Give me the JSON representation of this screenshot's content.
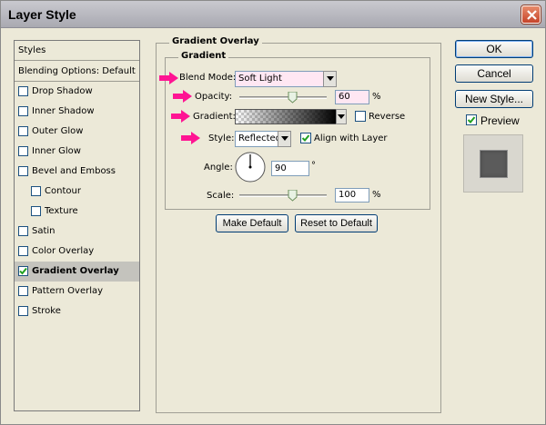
{
  "window": {
    "title": "Layer Style"
  },
  "sidebar": {
    "styles_label": "Styles",
    "blending_label": "Blending Options: Default",
    "items": [
      {
        "label": "Drop Shadow",
        "checked": false,
        "indent": false,
        "selected": false
      },
      {
        "label": "Inner Shadow",
        "checked": false,
        "indent": false,
        "selected": false
      },
      {
        "label": "Outer Glow",
        "checked": false,
        "indent": false,
        "selected": false
      },
      {
        "label": "Inner Glow",
        "checked": false,
        "indent": false,
        "selected": false
      },
      {
        "label": "Bevel and Emboss",
        "checked": false,
        "indent": false,
        "selected": false
      },
      {
        "label": "Contour",
        "checked": false,
        "indent": true,
        "selected": false
      },
      {
        "label": "Texture",
        "checked": false,
        "indent": true,
        "selected": false
      },
      {
        "label": "Satin",
        "checked": false,
        "indent": false,
        "selected": false
      },
      {
        "label": "Color Overlay",
        "checked": false,
        "indent": false,
        "selected": false
      },
      {
        "label": "Gradient Overlay",
        "checked": true,
        "indent": false,
        "selected": true
      },
      {
        "label": "Pattern Overlay",
        "checked": false,
        "indent": false,
        "selected": false
      },
      {
        "label": "Stroke",
        "checked": false,
        "indent": false,
        "selected": false
      }
    ]
  },
  "panel": {
    "group_title": "Gradient Overlay",
    "subgroup_title": "Gradient",
    "blend_mode_label": "Blend Mode:",
    "blend_mode_value": "Soft Light",
    "opacity_label": "Opacity:",
    "opacity_value": "60",
    "opacity_fraction": 0.6,
    "percent": "%",
    "gradient_label": "Gradient:",
    "reverse_label": "Reverse",
    "reverse_checked": false,
    "style_label": "Style:",
    "style_value": "Reflected",
    "align_label": "Align with Layer",
    "align_checked": true,
    "angle_label": "Angle:",
    "angle_value": "90",
    "degree": "°",
    "scale_label": "Scale:",
    "scale_value": "100",
    "scale_fraction": 0.6,
    "make_default": "Make Default",
    "reset_default": "Reset to Default"
  },
  "buttons": {
    "ok": "OK",
    "cancel": "Cancel",
    "new_style": "New Style...",
    "preview_label": "Preview",
    "preview_checked": true
  },
  "colors": {
    "arrow": "#ff1493",
    "highlight_field": "#ffe7f3",
    "selected_row": "#c4c3bd"
  }
}
